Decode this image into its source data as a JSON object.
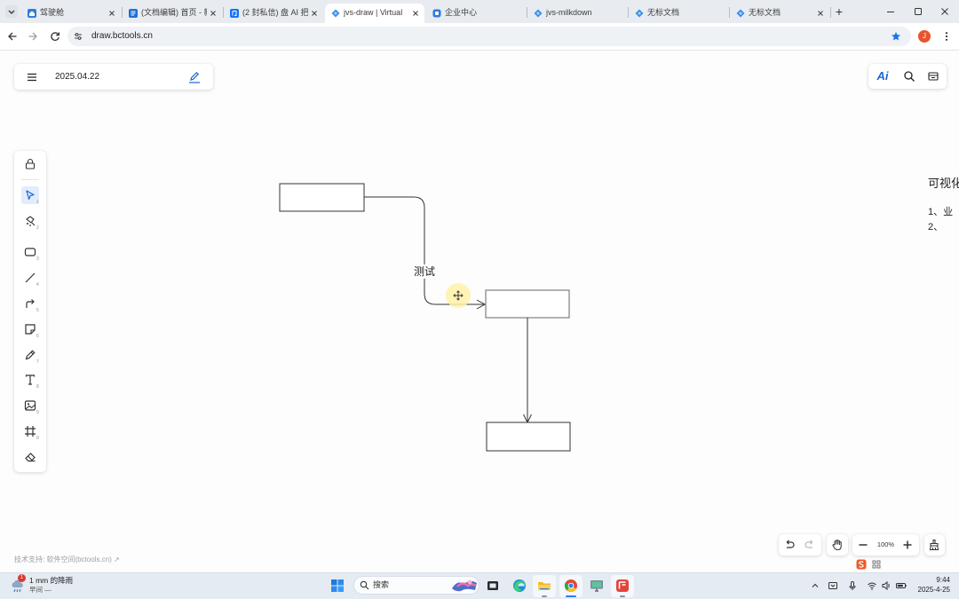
{
  "browser": {
    "tabs": [
      {
        "label": "驾驶舱",
        "icon": "dashboard-favicon"
      },
      {
        "label": "(文档编辑) 首页 - 新",
        "icon": "doc-favicon"
      },
      {
        "label": "(2 封私信) 盘 AI 把",
        "icon": "zhihu-favicon"
      },
      {
        "label": "jvs-draw | Virtual",
        "icon": "jvs-favicon",
        "active": true
      },
      {
        "label": "企业中心",
        "icon": "enterprise-favicon"
      },
      {
        "label": "jvs-milkdown",
        "icon": "jvs-favicon"
      },
      {
        "label": "无标文档",
        "icon": "jvs-favicon"
      },
      {
        "label": "无标文档",
        "icon": "jvs-favicon"
      }
    ],
    "new_tab_label": "+",
    "url": "draw.bctools.cn",
    "bookmarked": true,
    "profile_initial": "J",
    "accent_color": "#1a73e8"
  },
  "app": {
    "header": {
      "file_name": "2025.04.22",
      "ai_label": "Ai"
    },
    "toolbar": {
      "tools": [
        {
          "icon": "lock-icon"
        },
        {
          "icon": "pointer-icon",
          "shortcut": "1",
          "active": true
        },
        {
          "icon": "lasso-icon",
          "shortcut": "2"
        },
        {
          "icon": "rectangle-icon",
          "shortcut": "3"
        },
        {
          "icon": "line-icon",
          "shortcut": "4"
        },
        {
          "icon": "arrow-icon",
          "shortcut": "5"
        },
        {
          "icon": "note-icon",
          "shortcut": "6"
        },
        {
          "icon": "pen-icon",
          "shortcut": "7"
        },
        {
          "icon": "text-icon",
          "shortcut": "8"
        },
        {
          "icon": "image-icon",
          "shortcut": "9"
        },
        {
          "icon": "frame-icon",
          "shortcut": "0"
        },
        {
          "icon": "eraser-icon"
        }
      ]
    },
    "canvas": {
      "connector_label": "测试",
      "side_text": {
        "heading": "可视化",
        "item1": "1、业",
        "item2": "2、"
      }
    },
    "footer": {
      "support_text": "技术支持: 软件空间(bctools.cn) ↗",
      "zoom": "100%"
    }
  },
  "taskbar": {
    "weather": {
      "badge": "1",
      "line1": "1 mm 的降雨",
      "line2": "早间 —"
    },
    "search_placeholder": "搜索",
    "apps": [
      "task-view-icon",
      "edge-icon",
      "file-explorer-icon",
      "chrome-icon",
      "remote-app-icon",
      "red-app-icon"
    ],
    "clock": {
      "time": "9:44",
      "date": "2025-4-25"
    }
  }
}
